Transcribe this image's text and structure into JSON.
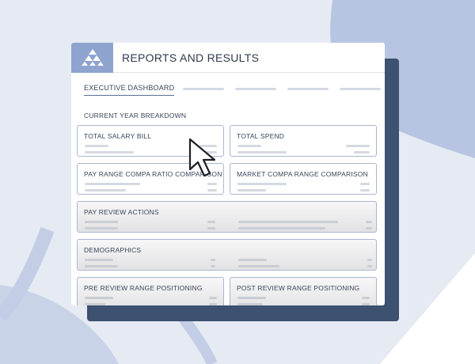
{
  "colors": {
    "background": "#e6ebf3",
    "accent_blue": "#8ea4cf",
    "navy_shadow": "#3d5170",
    "card_border": "#a9b7d3"
  },
  "window": {
    "logo_icon": "triangles-logo-icon",
    "title": "REPORTS AND RESULTS"
  },
  "tabs": {
    "active_label": "EXECUTIVE DASHBOARD"
  },
  "section": {
    "label": "CURRENT YEAR BREAKDOWN"
  },
  "cards": {
    "total_salary_bill": "TOTAL SALARY BILL",
    "total_spend": "TOTAL SPEND",
    "pay_range_compa": "PAY RANGE COMPA RATIO COMPARISON",
    "market_compa": "MARKET COMPA RANGE COMPARISON",
    "pay_review_actions": "PAY REVIEW ACTIONS",
    "demographics": "DEMOGRAPHICS",
    "pre_review": "PRE REVIEW RANGE POSITIONING",
    "post_review": "POST REVIEW RANGE POSITIONING"
  },
  "cursor_icon": "arrow-pointer-icon"
}
